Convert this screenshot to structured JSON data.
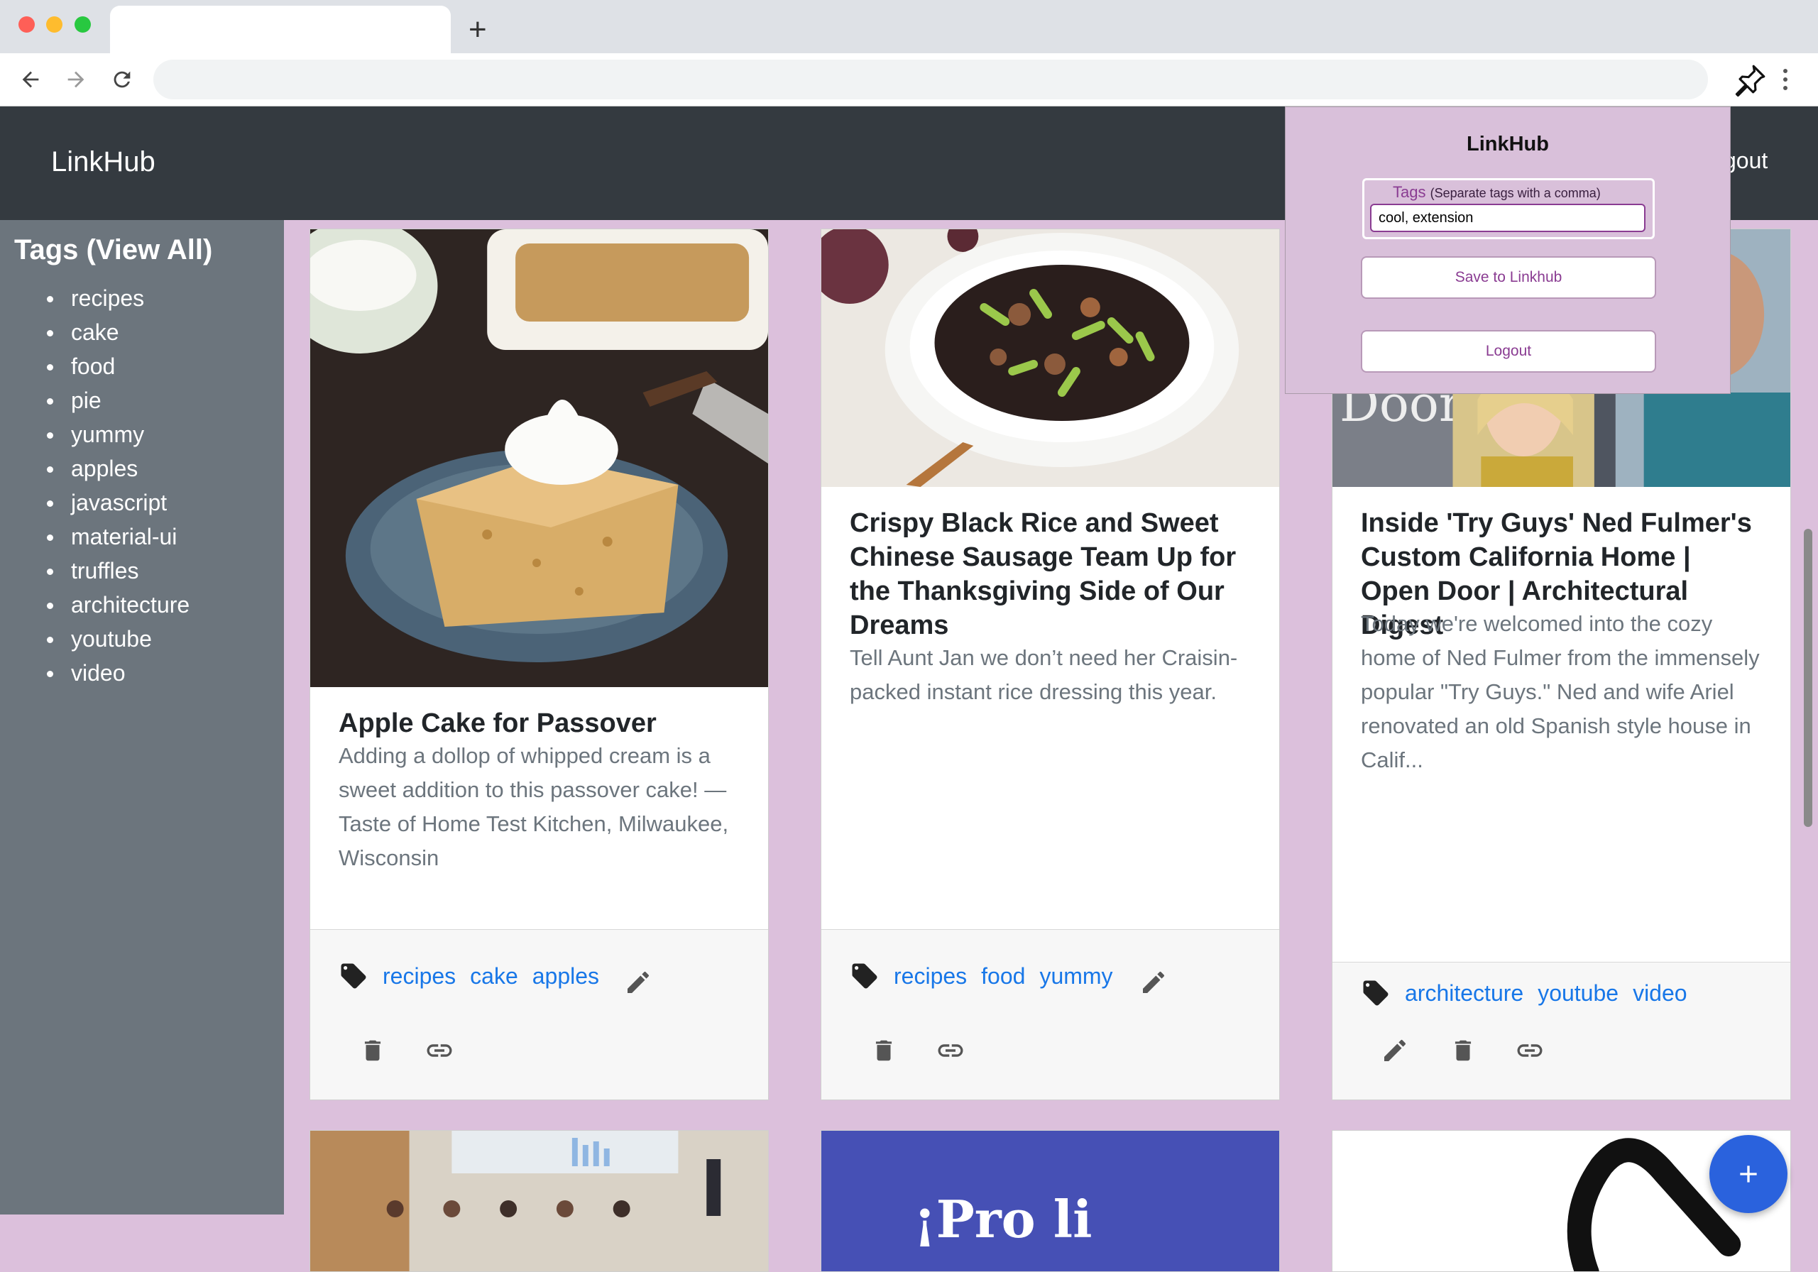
{
  "browser": {
    "new_tab_label": "+",
    "address_value": ""
  },
  "app": {
    "brand": "LinkHub",
    "logout_label": "gout"
  },
  "sidebar": {
    "title": "Tags (View All)",
    "tags": [
      "recipes",
      "cake",
      "food",
      "pie",
      "yummy",
      "apples",
      "javascript",
      "material-ui",
      "truffles",
      "architecture",
      "youtube",
      "video"
    ]
  },
  "cards": [
    {
      "title": "Apple Cake for Passover",
      "description": "Adding a dollop of whipped cream is a sweet addition to this passover cake! — Taste of Home Test Kitchen, Milwaukee, Wisconsin",
      "tags": [
        "recipes",
        "cake",
        "apples"
      ]
    },
    {
      "title": "Crispy Black Rice and Sweet Chinese Sausage Team Up for the Thanksgiving Side of Our Dreams",
      "description": "Tell Aunt Jan we don’t need her Craisin-packed instant rice dressing this year.",
      "tags": [
        "recipes",
        "food",
        "yummy"
      ]
    },
    {
      "title": "Inside 'Try Guys' Ned Fulmer's Custom California Home | Open Door | Architectural Digest",
      "description": "Today we're welcomed into the cozy home of Ned Fulmer from the immensely popular \"Try Guys.\" Ned and wife Ariel renovated an old Spanish style house in Calif...",
      "tags": [
        "architecture",
        "youtube",
        "video"
      ],
      "image_text": "Door AD"
    }
  ],
  "bottom_cards": [
    {
      "image_text": ""
    },
    {
      "image_text": "¡Pro li"
    },
    {
      "image_text": ""
    }
  ],
  "popup": {
    "title": "LinkHub",
    "tags_legend": "Tags",
    "tags_hint": "(Separate tags with a comma)",
    "tags_value": "cool, extension",
    "save_label": "Save to Linkhub",
    "logout_label": "Logout"
  },
  "fab": {
    "label": "+"
  },
  "colors": {
    "page_bg": "#dcc0dc",
    "appbar": "#343a40",
    "sidebar": "#6c757d",
    "tag_link": "#1877e8",
    "popup_bg": "#d9c0da",
    "popup_accent": "#8a3c92",
    "fab": "#2a62dd"
  },
  "icons": [
    "back-arrow-icon",
    "forward-arrow-icon",
    "reload-icon",
    "pin-icon",
    "more-vert-icon",
    "tag-icon",
    "pencil-icon",
    "trash-icon",
    "link-icon",
    "plus-icon"
  ]
}
